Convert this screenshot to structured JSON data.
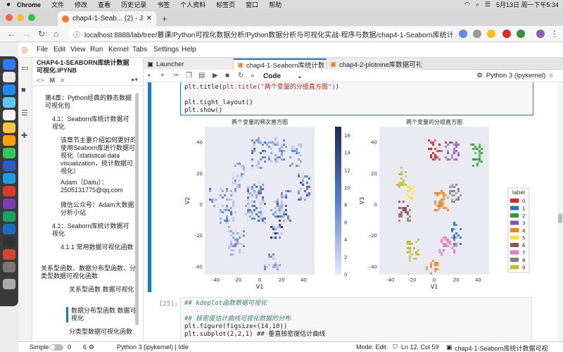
{
  "os_menu": {
    "app": "Chrome",
    "items": [
      "文件",
      "修改",
      "查看",
      "历史记录",
      "书签",
      "个人资料",
      "标签页",
      "窗口",
      "帮助"
    ],
    "clock": "5月13日 周一下午5:34"
  },
  "browser": {
    "tab_title": "chap4-1-Seab... (2) - Jupyte",
    "url": "localhost:8888/lab/tree/慕课/Python可视化数据分析/Python数据分析与可视化实战-程序与数据/chap4-1-Seaborn库统计数据可视化.ipynb"
  },
  "jupyter_menu": [
    "File",
    "Edit",
    "View",
    "Run",
    "Kernel",
    "Tabs",
    "Settings",
    "Help"
  ],
  "toc": {
    "title": "CHAP4-1-SEABORN库统计数据可视化.IPYNB",
    "items": [
      {
        "level": 1,
        "text": "第4章：Python经典的静态数据可视化包"
      },
      {
        "level": 2,
        "text": "4.1：Seaborn库统计数据可视化"
      },
      {
        "level": 3,
        "text": "该章节主要介绍如何更好的使用Seaborn库进行数据可视化（statistical data visualization，统计数据可视化）"
      },
      {
        "level": 3,
        "text": "Adam（Daitu）：2505131775@qq.com"
      },
      {
        "level": 3,
        "text": "微信公众号：Adam大数据分析小站"
      },
      {
        "level": 2,
        "text": "4.1：Seaborn库统计数据可视化"
      },
      {
        "level": 3,
        "text": "4.1.1 常用数据可视化函数"
      },
      {
        "level": 1,
        "text": "关系型函数、数据分布型函数、分类型数据可视化函数"
      },
      {
        "level": 4,
        "text": "关系型函数 数据可视化"
      },
      {
        "level": 4,
        "text": "数据分布型函数 数据可视化",
        "selected": true
      },
      {
        "level": 4,
        "text": "分类型数据可视化函数"
      }
    ]
  },
  "notebook_tabs": [
    {
      "label": "Launcher",
      "active": false
    },
    {
      "label": "chap4-1-Seaborn库统计数",
      "active": true
    },
    {
      "label": "chap4-2-plotnine库数据可礼",
      "active": false
    }
  ],
  "toolbar": {
    "cell_type": "Code",
    "kernel": "Python 3 (ipykernel)"
  },
  "code_top": [
    "plt.title(\"两个变量的分组直方图\")",
    "",
    "plt.tight_layout()",
    "plt.show()"
  ],
  "cell25": {
    "prompt": "[25]:",
    "lines": [
      "## kdeplot函数数据可视化",
      "",
      "## 核密度估计曲线可视化数据的分布",
      "plt.figure(figsize=(14,10))",
      "plt.subplot(2,2,1)   ## 垂直核密度估计曲线"
    ]
  },
  "status": {
    "mode_label": "Simple",
    "count_a": "0",
    "count_b": "6",
    "kernel": "Python 3 (ipykernel) | Idle",
    "edit_mode": "Mode: Edit",
    "position": "Ln 12, Col 59",
    "file": "chap4-1-Seaborn库统计数据可视化.ipynb"
  },
  "chart_data": [
    {
      "type": "heatmap",
      "title": "两个变量的频次直方图",
      "xlabel": "V1",
      "ylabel": "V2",
      "xlim": [
        -50,
        50
      ],
      "ylim": [
        -45,
        50
      ],
      "xticks": [
        -40,
        -20,
        0,
        20,
        40
      ],
      "yticks": [
        -40,
        -20,
        0,
        20,
        40
      ],
      "colorbar": {
        "ticks": [
          0,
          2,
          4,
          6,
          8,
          10,
          12,
          14,
          16
        ],
        "range": [
          0,
          17
        ]
      },
      "clusters": [
        {
          "cx": -43,
          "cy": 5,
          "w": 6,
          "h": 12,
          "count": 10
        },
        {
          "cx": -30,
          "cy": 0,
          "w": 14,
          "h": 24,
          "count": 9
        },
        {
          "cx": -20,
          "cy": 18,
          "w": 10,
          "h": 18,
          "count": 7
        },
        {
          "cx": -22,
          "cy": -22,
          "w": 14,
          "h": 18,
          "count": 8
        },
        {
          "cx": -5,
          "cy": 2,
          "w": 18,
          "h": 26,
          "count": 10
        },
        {
          "cx": -2,
          "cy": 34,
          "w": 12,
          "h": 20,
          "count": 9
        },
        {
          "cx": 14,
          "cy": 35,
          "w": 18,
          "h": 16,
          "count": 8
        },
        {
          "cx": 15,
          "cy": -12,
          "w": 10,
          "h": 18,
          "count": 16
        },
        {
          "cx": 20,
          "cy": 0,
          "w": 14,
          "h": 20,
          "count": 11
        },
        {
          "cx": 32,
          "cy": 32,
          "w": 10,
          "h": 14,
          "count": 7
        },
        {
          "cx": 39,
          "cy": 12,
          "w": 10,
          "h": 18,
          "count": 11
        },
        {
          "cx": 10,
          "cy": -36,
          "w": 14,
          "h": 10,
          "count": 8
        }
      ]
    },
    {
      "type": "heatmap",
      "title": "两个变量的分组直方图",
      "xlabel": "V1",
      "ylabel": "V3",
      "xlim": [
        -50,
        50
      ],
      "ylim": [
        -45,
        50
      ],
      "xticks": [
        -40,
        -20,
        0,
        20,
        40
      ],
      "yticks": [
        -40,
        -20,
        0,
        20,
        40
      ],
      "legend": {
        "title": "label",
        "position": "right",
        "entries": [
          "0",
          "1",
          "2",
          "3",
          "4",
          "5",
          "6",
          "7",
          "8",
          "9"
        ]
      },
      "colors": [
        "#d62728",
        "#1f77b4",
        "#2ca02c",
        "#8c4fb0",
        "#ff7f0e",
        "#ffe033",
        "#8c564b",
        "#e377c2",
        "#7f7f7f",
        "#bcbd22"
      ],
      "clusters": [
        {
          "label": 0,
          "cx": 0,
          "cy": 36,
          "w": 12,
          "h": 12
        },
        {
          "label": 1,
          "cx": 20,
          "cy": -18,
          "w": 8,
          "h": 14
        },
        {
          "label": 2,
          "cx": 38,
          "cy": 32,
          "w": 10,
          "h": 14
        },
        {
          "label": 3,
          "cx": 15,
          "cy": 35,
          "w": 12,
          "h": 12
        },
        {
          "label": 4,
          "cx": 5,
          "cy": 2,
          "w": 12,
          "h": 14
        },
        {
          "label": 6,
          "cx": -28,
          "cy": -4,
          "w": 10,
          "h": 14
        },
        {
          "label": 7,
          "cx": 12,
          "cy": -26,
          "w": 16,
          "h": 12
        },
        {
          "label": 8,
          "cx": 18,
          "cy": 8,
          "w": 10,
          "h": 12
        },
        {
          "label": 9,
          "cx": -20,
          "cy": -28,
          "w": 10,
          "h": 14
        },
        {
          "label": 4,
          "cx": -2,
          "cy": -40,
          "w": 10,
          "h": 8
        },
        {
          "label": 9,
          "cx": -30,
          "cy": 18,
          "w": 8,
          "h": 12
        },
        {
          "label": 5,
          "cx": -22,
          "cy": 8,
          "w": 8,
          "h": 10
        }
      ]
    }
  ]
}
